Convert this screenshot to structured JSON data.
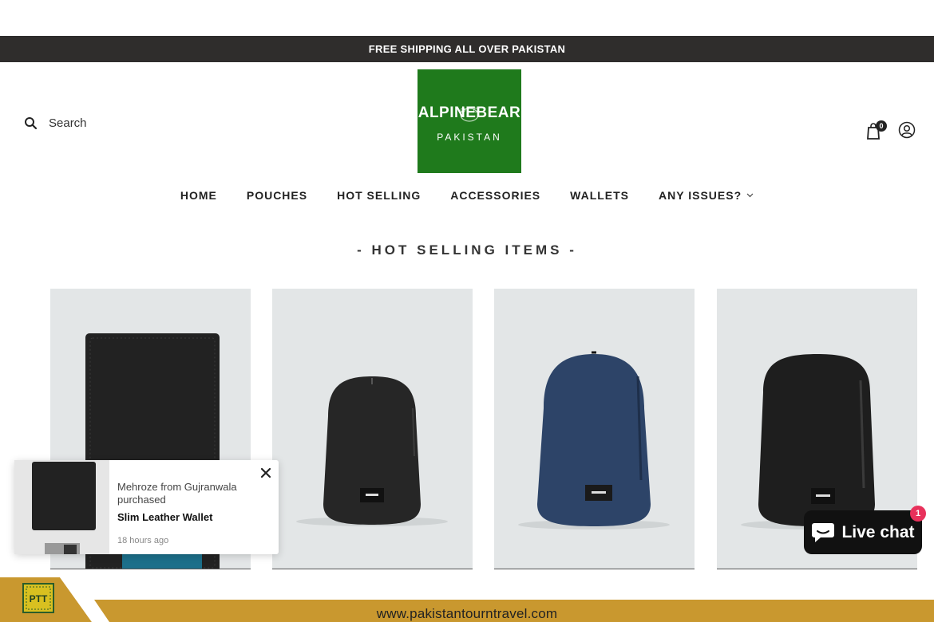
{
  "announcement": "FREE SHIPPING ALL OVER PAKISTAN",
  "search": {
    "label": "Search"
  },
  "logo": {
    "main": "ALPINEBEAR",
    "sub": "PAKISTAN"
  },
  "cart": {
    "count": "0"
  },
  "nav": {
    "items": [
      {
        "label": "HOME"
      },
      {
        "label": "POUCHES"
      },
      {
        "label": "HOT SELLING"
      },
      {
        "label": "ACCESSORIES"
      },
      {
        "label": "WALLETS"
      },
      {
        "label": "ANY ISSUES?"
      }
    ]
  },
  "section": {
    "title": "- HOT SELLING ITEMS -"
  },
  "products": [
    {
      "name": "Slim Leather Wallet",
      "color": "#1f1f1f"
    },
    {
      "name": "black backpack",
      "color": "#252525"
    },
    {
      "name": "navy backpack",
      "color": "#2d4468"
    },
    {
      "name": "black backpack",
      "color": "#1e1e1e"
    }
  ],
  "purchase_popup": {
    "message": "Mehroze from Gujranwala purchased",
    "product": "Slim Leather Wallet",
    "time": "18 hours ago"
  },
  "live_chat": {
    "label": "Live chat",
    "badge": "1"
  },
  "footer": {
    "url": "www.pakistantourntravel.com",
    "logo_text": "PTT",
    "accent": "#c9982f"
  },
  "colors": {
    "announce_bg": "#2f2d2c",
    "logo_bg": "#1f7a1c",
    "card_bg": "#e3e6e7",
    "badge": "#e8315b"
  }
}
